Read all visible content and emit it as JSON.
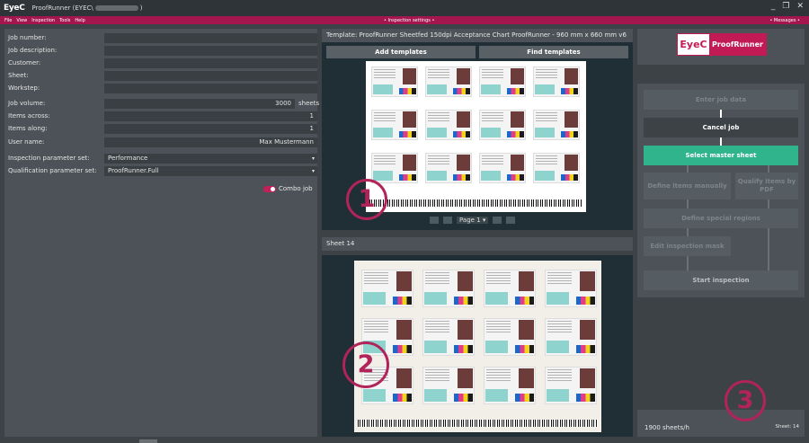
{
  "titlebar": {
    "logo": "EyeC",
    "title": "ProofRunner  (EYEC\\",
    "title_end": ")"
  },
  "window_controls": [
    "_",
    "❐",
    "✕"
  ],
  "menu": {
    "items": [
      "File",
      "View",
      "Inspection",
      "Tools",
      "Help"
    ],
    "center": "• Inspection settings •",
    "right": "• Messages •"
  },
  "form": {
    "job_number": {
      "label": "Job number:",
      "value": ""
    },
    "job_description": {
      "label": "Job description:",
      "value": ""
    },
    "customer": {
      "label": "Customer:",
      "value": ""
    },
    "sheet": {
      "label": "Sheet:",
      "value": ""
    },
    "workstep": {
      "label": "Workstep:",
      "value": ""
    },
    "job_volume": {
      "label": "Job volume:",
      "value": "3000",
      "unit": "sheets"
    },
    "items_across": {
      "label": "Items across:",
      "value": "1"
    },
    "items_along": {
      "label": "Items along:",
      "value": "1"
    },
    "user_name": {
      "label": "User name:",
      "value": "Max Mustermann"
    },
    "inspection_set": {
      "label": "Inspection parameter set:",
      "value": "Performance"
    },
    "qualification_set": {
      "label": "Qualification parameter set:",
      "value": "ProofRunner.Full"
    },
    "combo_job": {
      "label": "Combo job",
      "on": true
    }
  },
  "template": {
    "header": "Template: ProofRunner Sheetfed 150dpi Acceptance Chart ProofRunner - 960 mm x 660 mm v6",
    "add_label": "Add templates",
    "find_label": "Find templates",
    "page_label": "Page 1",
    "marker": "1"
  },
  "sheet_view": {
    "header": "Sheet 14",
    "marker": "2"
  },
  "brand": {
    "eyec": "EyeC",
    "product": "ProofRunner"
  },
  "workflow": {
    "enter_job": "Enter job data",
    "cancel_job": "Cancel job",
    "select_master": "Select master sheet",
    "define_manual": "Define items manually",
    "qualify_pdf": "Qualify items by PDF",
    "define_special": "Define special regions",
    "edit_mask": "Edit inspection mask",
    "start_inspection": "Start inspection"
  },
  "status": {
    "speed": "1900 sheets/h",
    "sheet": "Sheet: 14",
    "marker": "3"
  },
  "colors": {
    "accent": "#a3174e",
    "green": "#2fb48c",
    "panel": "#4c5257",
    "dark": "#1f2f35"
  }
}
